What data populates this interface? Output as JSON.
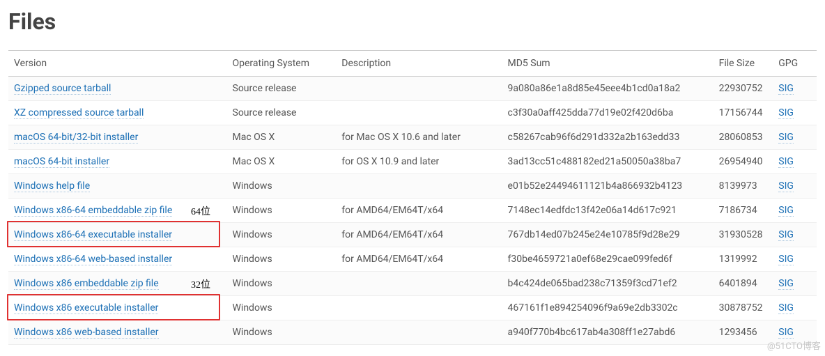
{
  "heading": "Files",
  "columns": [
    "Version",
    "Operating System",
    "Description",
    "MD5 Sum",
    "File Size",
    "GPG"
  ],
  "gpg_label": "SIG",
  "annotations": {
    "bit64": "64位",
    "bit32": "32位"
  },
  "watermark": "@51CTO博客",
  "rows": [
    {
      "version": "Gzipped source tarball",
      "os": "Source release",
      "desc": "",
      "md5": "9a080a86e1a8d85e45eee4b1cd0a18a2",
      "size": "22930752"
    },
    {
      "version": "XZ compressed source tarball",
      "os": "Source release",
      "desc": "",
      "md5": "c3f30a0aff425dda77d19e02f420d6ba",
      "size": "17156744"
    },
    {
      "version": "macOS 64-bit/32-bit installer",
      "os": "Mac OS X",
      "desc": "for Mac OS X 10.6 and later",
      "md5": "c58267cab96f6d291d332a2b163edd33",
      "size": "28060853"
    },
    {
      "version": "macOS 64-bit installer",
      "os": "Mac OS X",
      "desc": "for OS X 10.9 and later",
      "md5": "3ad13cc51c488182ed21a50050a38ba7",
      "size": "26954940"
    },
    {
      "version": "Windows help file",
      "os": "Windows",
      "desc": "",
      "md5": "e01b52e24494611121b4a866932b4123",
      "size": "8139973"
    },
    {
      "version": "Windows x86-64 embeddable zip file",
      "os": "Windows",
      "desc": "for AMD64/EM64T/x64",
      "md5": "7148ec14edfdc13f42e06a14d617c921",
      "size": "7186734"
    },
    {
      "version": "Windows x86-64 executable installer",
      "os": "Windows",
      "desc": "for AMD64/EM64T/x64",
      "md5": "767db14ed07b245e24e10785f9d28e29",
      "size": "31930528",
      "highlight": true
    },
    {
      "version": "Windows x86-64 web-based installer",
      "os": "Windows",
      "desc": "for AMD64/EM64T/x64",
      "md5": "f30be4659721a0ef68e29cae099fed6f",
      "size": "1319992"
    },
    {
      "version": "Windows x86 embeddable zip file",
      "os": "Windows",
      "desc": "",
      "md5": "b4c424de065bad238c71359f3cd71ef2",
      "size": "6401894"
    },
    {
      "version": "Windows x86 executable installer",
      "os": "Windows",
      "desc": "",
      "md5": "467161f1e894254096f9a69e2db3302c",
      "size": "30878752",
      "highlight": true
    },
    {
      "version": "Windows x86 web-based installer",
      "os": "Windows",
      "desc": "",
      "md5": "a940f770b4bc617ab4a308ff1e27abd6",
      "size": "1293456"
    }
  ]
}
